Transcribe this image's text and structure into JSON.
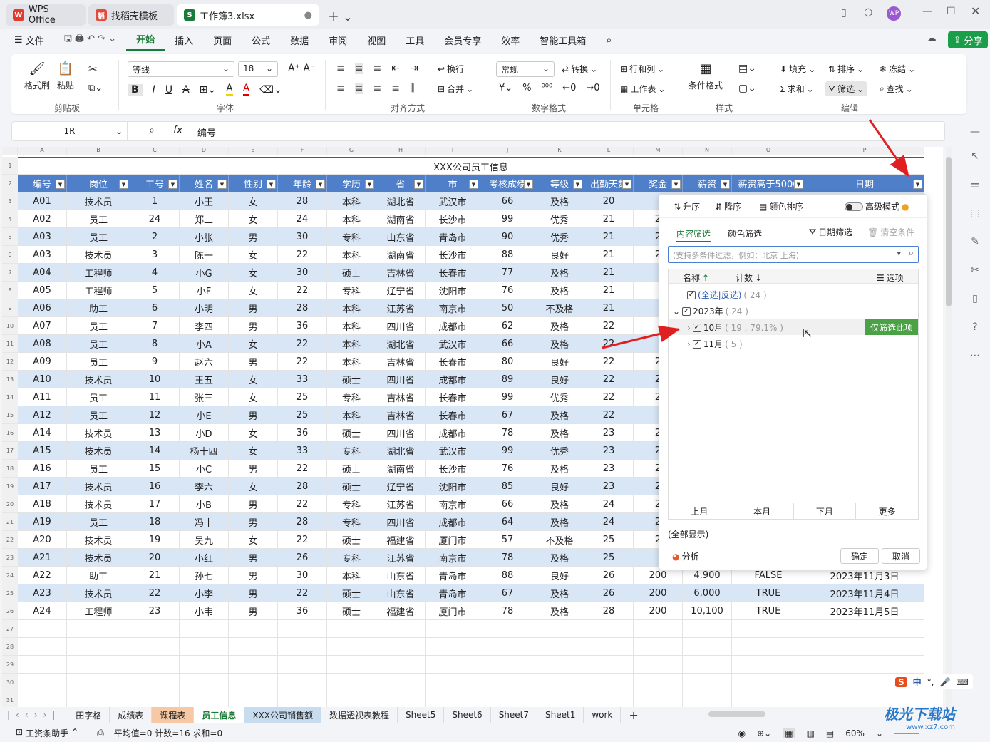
{
  "tabs": [
    "WPS Office",
    "找稻壳模板",
    "工作簿3.xlsx"
  ],
  "menu": [
    "文件",
    "开始",
    "插入",
    "页面",
    "公式",
    "数据",
    "审阅",
    "视图",
    "工具",
    "会员专享",
    "效率",
    "智能工具箱"
  ],
  "share": "分享",
  "ribbon": {
    "format_brush": "格式刷",
    "paste": "粘贴",
    "clipboard": "剪贴板",
    "font_name": "等线",
    "font_size": "18",
    "font": "字体",
    "wrap": "换行",
    "merge": "合并",
    "align": "对齐方式",
    "number_format": "常规",
    "convert": "转换",
    "number": "数字格式",
    "rowcol": "行和列",
    "worksheet": "工作表",
    "cell": "单元格",
    "cond_format": "条件格式",
    "style": "样式",
    "fill": "填充",
    "sort": "排序",
    "freeze": "冻结",
    "sum": "求和",
    "filter": "筛选",
    "find": "查找",
    "edit": "编辑"
  },
  "formula": {
    "namebox": "1R",
    "fx": "fx",
    "value": "编号"
  },
  "sheet": {
    "title": "XXX公司员工信息",
    "col_letters": [
      "A",
      "B",
      "C",
      "D",
      "E",
      "F",
      "G",
      "H",
      "I",
      "J",
      "K",
      "L",
      "M",
      "N",
      "O",
      "P"
    ],
    "headers": [
      "编号",
      "岗位",
      "工号",
      "姓名",
      "性别",
      "年龄",
      "学历",
      "省",
      "市",
      "考核成绩",
      "等级",
      "出勤天数",
      "奖金",
      "薪资",
      "薪资高于5000",
      "日期"
    ],
    "rows": [
      [
        "A01",
        "技术员",
        "1",
        "小王",
        "女",
        "28",
        "本科",
        "湖北省",
        "武汉市",
        "66",
        "及格",
        "20",
        "",
        "",
        "",
        ""
      ],
      [
        "A02",
        "员工",
        "24",
        "郑二",
        "女",
        "24",
        "本科",
        "湖南省",
        "长沙市",
        "99",
        "优秀",
        "21",
        "2",
        "",
        "",
        ""
      ],
      [
        "A03",
        "员工",
        "2",
        "小张",
        "男",
        "30",
        "专科",
        "山东省",
        "青岛市",
        "90",
        "优秀",
        "21",
        "2",
        "",
        "",
        ""
      ],
      [
        "A03",
        "技术员",
        "3",
        "陈一",
        "女",
        "22",
        "本科",
        "湖南省",
        "长沙市",
        "88",
        "良好",
        "21",
        "2",
        "",
        "",
        ""
      ],
      [
        "A04",
        "工程师",
        "4",
        "小G",
        "女",
        "30",
        "硕士",
        "吉林省",
        "长春市",
        "77",
        "及格",
        "21",
        "",
        "",
        "",
        ""
      ],
      [
        "A05",
        "工程师",
        "5",
        "小F",
        "女",
        "22",
        "专科",
        "辽宁省",
        "沈阳市",
        "76",
        "及格",
        "21",
        "",
        "",
        "",
        ""
      ],
      [
        "A06",
        "助工",
        "6",
        "小明",
        "男",
        "28",
        "本科",
        "江苏省",
        "南京市",
        "50",
        "不及格",
        "21",
        "",
        "",
        "",
        ""
      ],
      [
        "A07",
        "员工",
        "7",
        "李四",
        "男",
        "36",
        "本科",
        "四川省",
        "成都市",
        "62",
        "及格",
        "22",
        "",
        "",
        "",
        ""
      ],
      [
        "A08",
        "员工",
        "8",
        "小A",
        "女",
        "22",
        "本科",
        "湖北省",
        "武汉市",
        "66",
        "及格",
        "22",
        "",
        "",
        "",
        ""
      ],
      [
        "A09",
        "员工",
        "9",
        "赵六",
        "男",
        "22",
        "本科",
        "吉林省",
        "长春市",
        "80",
        "良好",
        "22",
        "2",
        "",
        "",
        ""
      ],
      [
        "A10",
        "技术员",
        "10",
        "王五",
        "女",
        "33",
        "硕士",
        "四川省",
        "成都市",
        "89",
        "良好",
        "22",
        "2",
        "",
        "",
        ""
      ],
      [
        "A11",
        "员工",
        "11",
        "张三",
        "女",
        "25",
        "专科",
        "吉林省",
        "长春市",
        "99",
        "优秀",
        "22",
        "2",
        "",
        "",
        ""
      ],
      [
        "A12",
        "员工",
        "12",
        "小E",
        "男",
        "25",
        "本科",
        "吉林省",
        "长春市",
        "67",
        "及格",
        "22",
        "",
        "",
        "",
        ""
      ],
      [
        "A14",
        "技术员",
        "13",
        "小D",
        "女",
        "36",
        "硕士",
        "四川省",
        "成都市",
        "78",
        "及格",
        "23",
        "2",
        "",
        "",
        ""
      ],
      [
        "A15",
        "技术员",
        "14",
        "杨十四",
        "女",
        "33",
        "专科",
        "湖北省",
        "武汉市",
        "99",
        "优秀",
        "23",
        "2",
        "",
        "",
        ""
      ],
      [
        "A16",
        "员工",
        "15",
        "小C",
        "男",
        "22",
        "硕士",
        "湖南省",
        "长沙市",
        "76",
        "及格",
        "23",
        "2",
        "",
        "",
        ""
      ],
      [
        "A17",
        "技术员",
        "16",
        "李六",
        "女",
        "28",
        "硕士",
        "辽宁省",
        "沈阳市",
        "85",
        "良好",
        "23",
        "2",
        "",
        "",
        ""
      ],
      [
        "A18",
        "技术员",
        "17",
        "小B",
        "男",
        "22",
        "专科",
        "江苏省",
        "南京市",
        "66",
        "及格",
        "24",
        "2",
        "",
        "",
        ""
      ],
      [
        "A19",
        "员工",
        "18",
        "冯十",
        "男",
        "28",
        "专科",
        "四川省",
        "成都市",
        "64",
        "及格",
        "24",
        "2",
        "",
        "",
        ""
      ],
      [
        "A20",
        "技术员",
        "19",
        "吴九",
        "女",
        "22",
        "硕士",
        "福建省",
        "厦门市",
        "57",
        "不及格",
        "25",
        "2",
        "",
        "",
        ""
      ],
      [
        "A21",
        "技术员",
        "20",
        "小红",
        "男",
        "26",
        "专科",
        "江苏省",
        "南京市",
        "78",
        "及格",
        "25",
        "",
        "",
        "",
        ""
      ],
      [
        "A22",
        "助工",
        "21",
        "孙七",
        "男",
        "30",
        "本科",
        "山东省",
        "青岛市",
        "88",
        "良好",
        "26",
        "200",
        "4,900",
        "FALSE",
        "2023年11月3日"
      ],
      [
        "A23",
        "技术员",
        "22",
        "小李",
        "男",
        "22",
        "硕士",
        "山东省",
        "青岛市",
        "67",
        "及格",
        "26",
        "200",
        "6,000",
        "TRUE",
        "2023年11月4日"
      ],
      [
        "A24",
        "工程师",
        "23",
        "小韦",
        "男",
        "36",
        "硕士",
        "福建省",
        "厦门市",
        "78",
        "及格",
        "28",
        "200",
        "10,100",
        "TRUE",
        "2023年11月5日"
      ]
    ]
  },
  "filter_panel": {
    "asc": "升序",
    "desc": "降序",
    "color_sort": "颜色排序",
    "advanced": "高级模式",
    "tab_content": "内容筛选",
    "tab_color": "颜色筛选",
    "date_filter": "日期筛选",
    "clear": "清空条件",
    "search_placeholder": "(支持多条件过滤，例如：北京 上海)",
    "col_name": "名称",
    "col_count": "计数",
    "options": "选项",
    "select_all": "(全选|反选)",
    "select_all_count": "( 24 )",
    "year": "2023年",
    "year_count": "( 24 )",
    "oct": "10月",
    "oct_count": "( 19 , 79.1% )",
    "only_this": "仅筛选此项",
    "nov": "11月",
    "nov_count": "( 5 )",
    "quick": [
      "上月",
      "本月",
      "下月",
      "更多"
    ],
    "show_all": "(全部显示)",
    "analysis": "分析",
    "ok": "确定",
    "cancel": "取消"
  },
  "sheet_tabs": [
    "田字格",
    "成绩表",
    "课程表",
    "员工信息",
    "XXX公司销售额",
    "数据透视表教程",
    "Sheet5",
    "Sheet6",
    "Sheet7",
    "Sheet1",
    "work"
  ],
  "status": {
    "assistant": "工资条助手",
    "stats": "平均值=0  计数=16  求和=0",
    "zoom": "60%"
  },
  "ime": "中",
  "watermark": "极光下载站",
  "watermark_url": "www.xz7.com"
}
